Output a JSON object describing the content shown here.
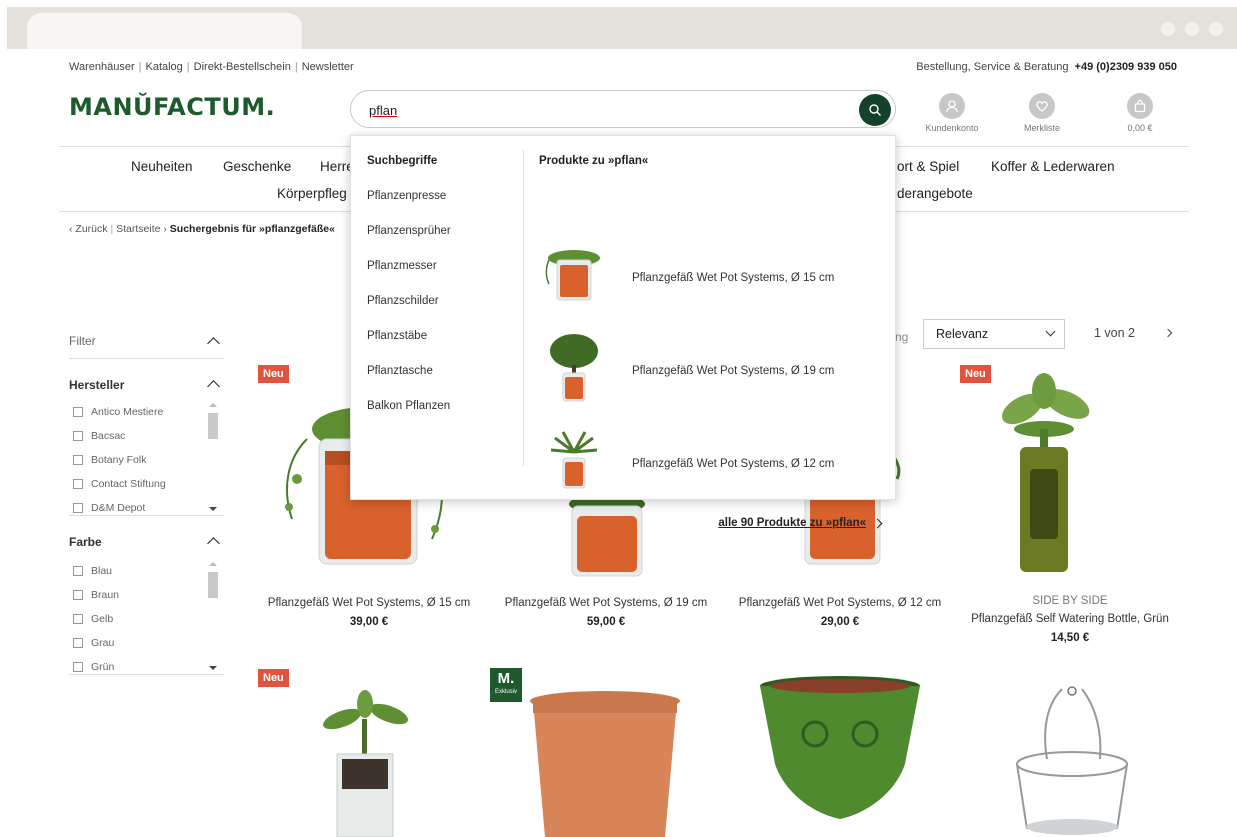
{
  "top": {
    "links": [
      "Warenhäuser",
      "Katalog",
      "Direkt-Bestellschein",
      "Newsletter"
    ],
    "service_label": "Bestellung, Service & Beratung",
    "phone": "+49 (0)2309 939 050"
  },
  "logo": "MANŬFACTUM.",
  "search": {
    "value": "pflan"
  },
  "header_icons": {
    "account": "Kundenkonto",
    "wishlist": "Merkliste",
    "cart": "0,00 €"
  },
  "nav": {
    "row1": [
      "Neuheiten",
      "Geschenke",
      "Herre",
      "ort & Spiel",
      "Koffer & Lederwaren"
    ],
    "row2": [
      "Körperpfleg",
      "derangebote"
    ]
  },
  "breadcrumb": {
    "back": "Zurück",
    "home": "Startseite",
    "current": "Suchergebnis für »pflanzgefäße«"
  },
  "filter": {
    "title": "Filter",
    "sections": [
      {
        "title": "Hersteller",
        "items": [
          "Antico Mestiere",
          "Bacsac",
          "Botany Folk",
          "Contact Stiftung",
          "D&M Depot"
        ]
      },
      {
        "title": "Farbe",
        "items": [
          "Blau",
          "Braun",
          "Gelb",
          "Grau",
          "Grün"
        ]
      }
    ]
  },
  "sort": {
    "label": "ng",
    "value": "Relevanz"
  },
  "pager": {
    "text": "1 von 2"
  },
  "products": [
    {
      "badge": "Neu",
      "brand": "",
      "name": "Pflanzgefäß Wet Pot Systems, Ø 15 cm",
      "price": "39,00 €"
    },
    {
      "badge": "",
      "brand": "",
      "name": "Pflanzgefäß Wet Pot Systems, Ø 19 cm",
      "price": "59,00 €"
    },
    {
      "badge": "",
      "brand": "",
      "name": "Pflanzgefäß Wet Pot Systems, Ø 12 cm",
      "price": "29,00 €"
    },
    {
      "badge": "Neu",
      "brand": "SIDE BY SIDE",
      "name": "Pflanzgefäß Self Watering Bottle, Grün",
      "price": "14,50 €"
    }
  ],
  "row2_badges": {
    "neu": "Neu",
    "m_logo": "M.",
    "m_text": "Exklusiv"
  },
  "dropdown": {
    "terms_title": "Suchbegriffe",
    "terms": [
      "Pflanzenpresse",
      "Pflanzensprüher",
      "Pflanzmesser",
      "Pflanzschilder",
      "Pflanzstäbe",
      "Pflanztasche",
      "Balkon Pflanzen"
    ],
    "products_title": "Produkte zu »pflan«",
    "products": [
      "Pflanzgefäß Wet Pot Systems, Ø 15 cm",
      "Pflanzgefäß Wet Pot Systems, Ø 19 cm",
      "Pflanzgefäß Wet Pot Systems, Ø 12 cm"
    ],
    "all_link": "alle 90 Produkte zu »pflan«"
  },
  "colors": {
    "brand_green": "#13412a",
    "badge_red": "#e2533d"
  }
}
